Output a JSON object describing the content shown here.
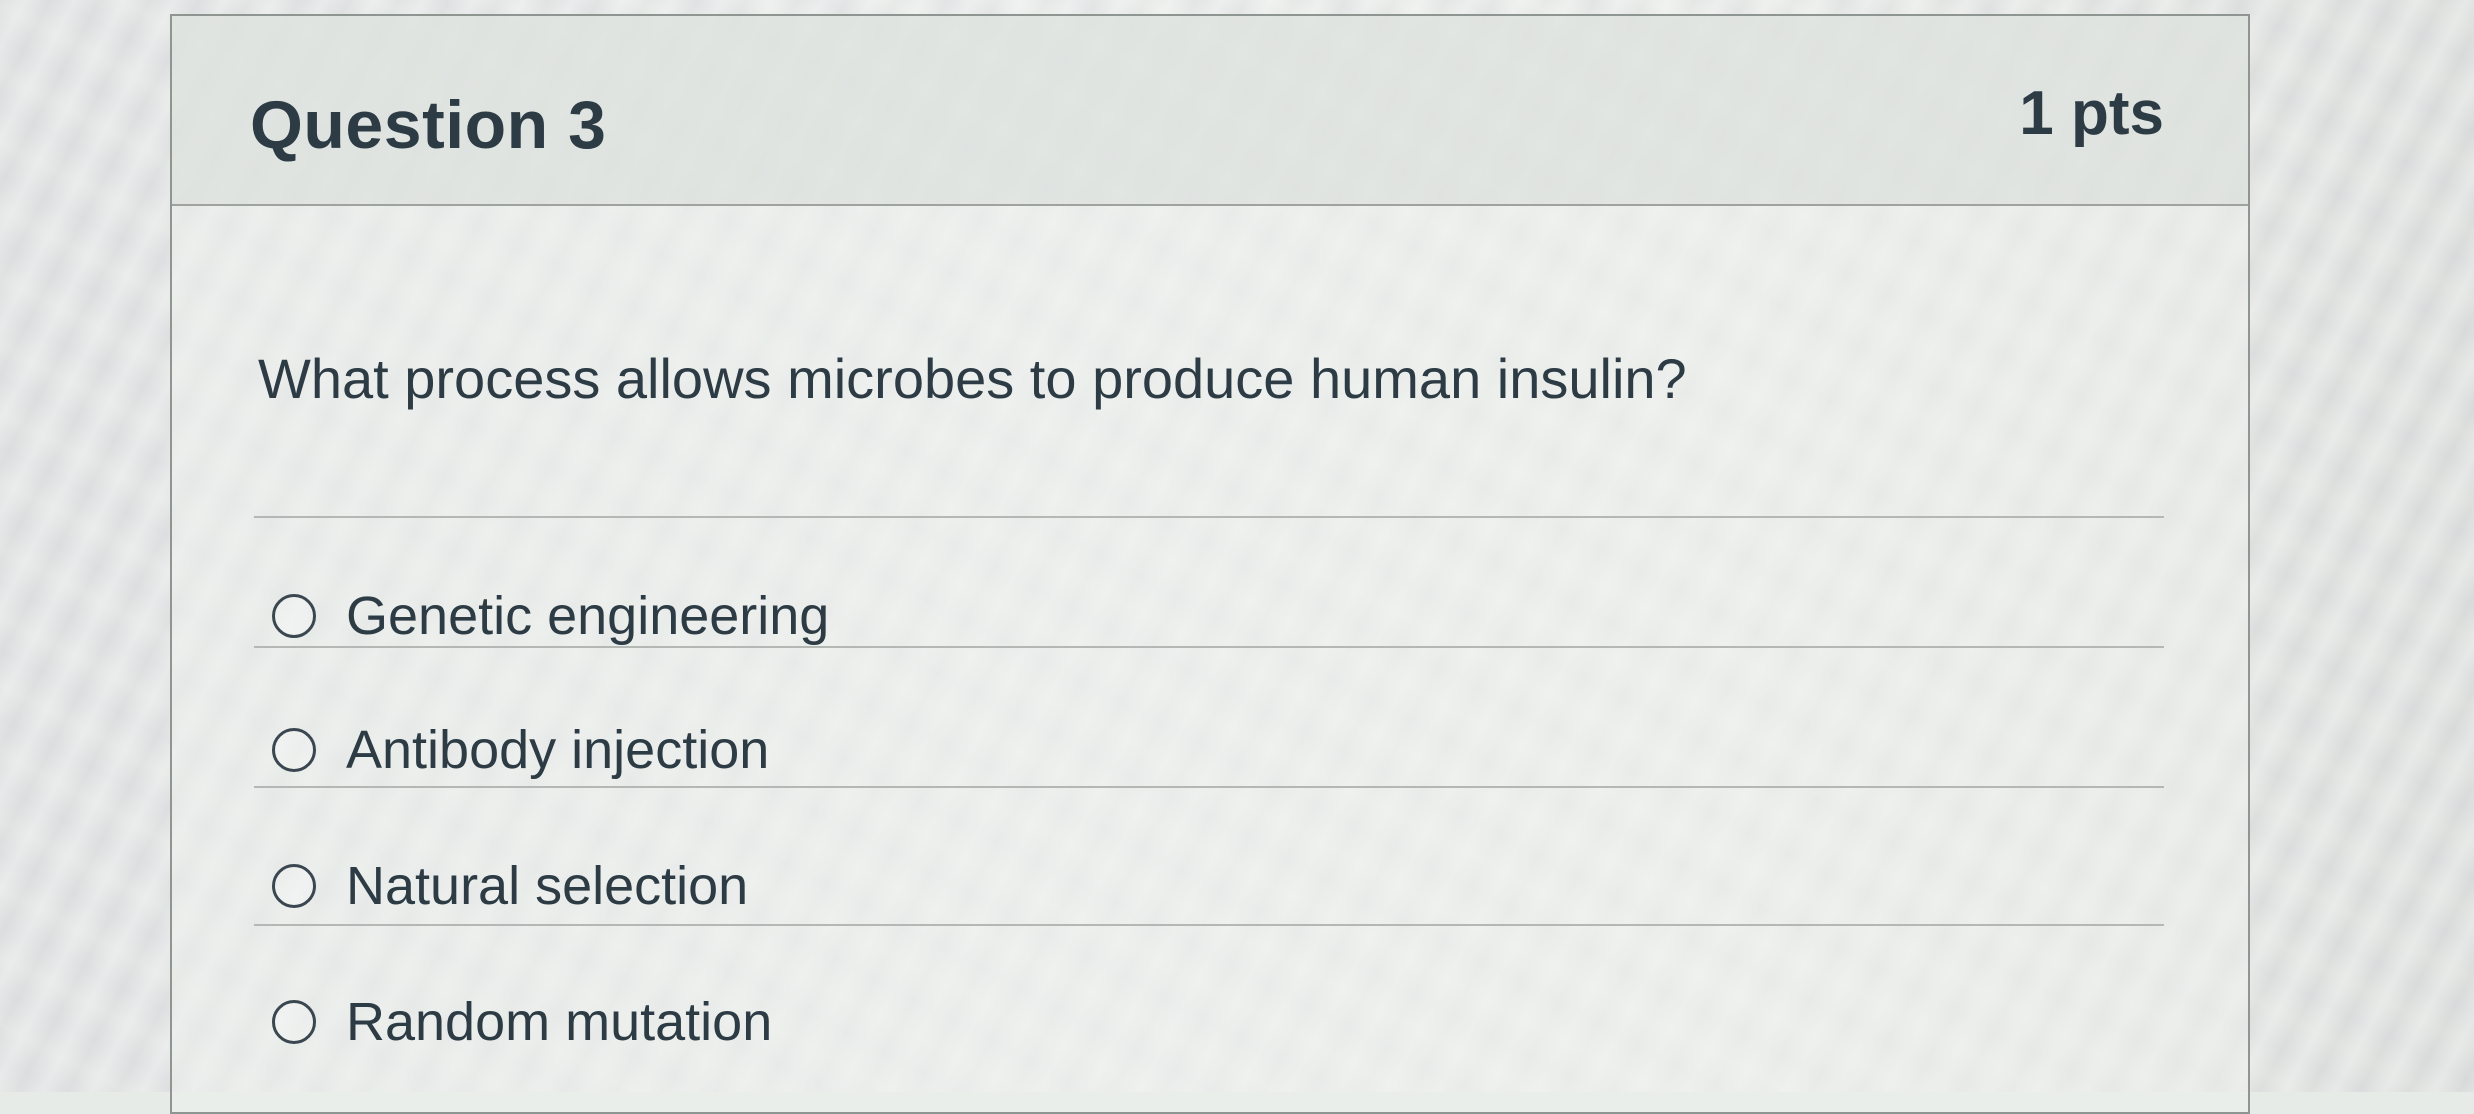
{
  "question": {
    "title": "Question 3",
    "points": "1 pts",
    "text": "What process allows microbes to produce human insulin?",
    "answers": [
      {
        "label": "Genetic engineering",
        "selected": false
      },
      {
        "label": "Antibody injection",
        "selected": false
      },
      {
        "label": "Natural selection",
        "selected": false
      },
      {
        "label": "Random mutation",
        "selected": false
      }
    ]
  }
}
